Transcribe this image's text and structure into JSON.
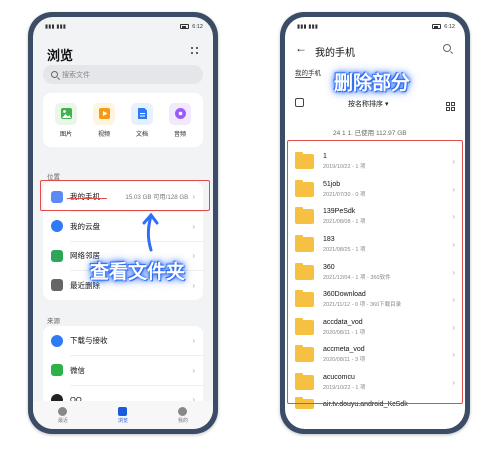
{
  "left_phone": {
    "status": {
      "signal": "▮▮▮ ▮▮▮",
      "time": "6:12"
    },
    "title": "浏览",
    "search_placeholder": "搜索文件",
    "categories": [
      {
        "label": "图片",
        "icon": "image-icon"
      },
      {
        "label": "视频",
        "icon": "video-icon"
      },
      {
        "label": "文档",
        "icon": "document-icon"
      },
      {
        "label": "音频",
        "icon": "audio-icon"
      }
    ],
    "location_label": "位置",
    "locations": [
      {
        "label": "我的手机",
        "meta": "15.03 GB 可用/128 GB",
        "icon": "phone-icon",
        "color": "#5b8af5"
      },
      {
        "label": "我的云盘",
        "meta": "",
        "icon": "cloud-icon",
        "color": "#2f7af5"
      },
      {
        "label": "网络邻居",
        "meta": "",
        "icon": "network-icon",
        "color": "#2fa55a"
      },
      {
        "label": "最近删除",
        "meta": "",
        "icon": "trash-icon",
        "color": "#666666"
      }
    ],
    "source_label": "来源",
    "sources": [
      {
        "label": "下载与接收",
        "icon": "download-icon",
        "color": "#2f7af5"
      },
      {
        "label": "微信",
        "icon": "wechat-icon",
        "color": "#2fb14a"
      },
      {
        "label": "QQ",
        "icon": "qq-icon",
        "color": "#222222"
      }
    ],
    "nav": [
      {
        "label": "最近",
        "active": false
      },
      {
        "label": "浏览",
        "active": true
      },
      {
        "label": "我的",
        "active": false
      }
    ],
    "annotation": "查看文件夹"
  },
  "right_phone": {
    "status": {
      "signal": "▮▮▮ ▮▮▮",
      "time": "6:12"
    },
    "title": "我的手机",
    "breadcrumb": "我的手机",
    "sort_label": "按名称排序 ▾",
    "storage_text": "24 1 1. 已使用 112.97 GB",
    "annotation": "删除部分",
    "files": [
      {
        "name": "1",
        "meta": "2019/10/22 - 1 项"
      },
      {
        "name": "51job",
        "meta": "2021/07/30 - 0 项"
      },
      {
        "name": "139PeSdk",
        "meta": "2021/08/08 - 1 项"
      },
      {
        "name": "183",
        "meta": "2021/08/25 - 1 项"
      },
      {
        "name": "360",
        "meta": "2021/12/04 - 1 项 - 360软件"
      },
      {
        "name": "360Download",
        "meta": "2021/11/12 - 0 项 - 360下载目录"
      },
      {
        "name": "accdata_vod",
        "meta": "2020/08/11 - 1 项"
      },
      {
        "name": "accmeta_vod",
        "meta": "2020/08/11 - 3 项"
      },
      {
        "name": "acucomcu",
        "meta": "2019/10/22 - 1 项"
      },
      {
        "name": "air.tv.douyu.android_KcSdk",
        "meta": ""
      }
    ]
  },
  "colors": {
    "accent": "#1a5adb",
    "highlight": "#e04c4c",
    "folder": "#f6c143"
  }
}
